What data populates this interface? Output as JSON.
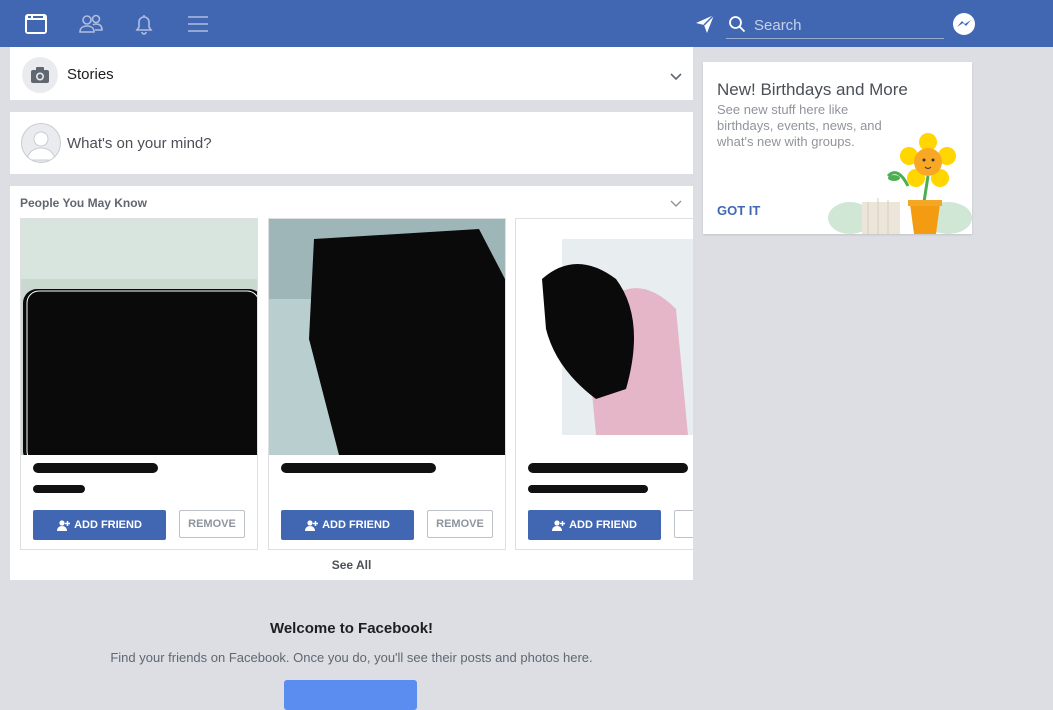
{
  "topbar": {
    "search": {
      "placeholder": "Search"
    },
    "icons": [
      "news-feed-icon",
      "friends-icon",
      "notifications-icon",
      "menu-icon",
      "send-icon",
      "search-icon",
      "messenger-icon"
    ]
  },
  "stories": {
    "label": "Stories"
  },
  "composer": {
    "prompt": "What's on your mind?"
  },
  "pymk": {
    "title": "People You May Know",
    "cards": [
      {
        "add_label": "ADD FRIEND",
        "remove_label": "REMOVE"
      },
      {
        "add_label": "ADD FRIEND",
        "remove_label": "REMOVE"
      },
      {
        "add_label": "ADD FRIEND"
      }
    ],
    "see_all": "See All"
  },
  "birthdays": {
    "title": "New! Birthdays and More",
    "description": "See new stuff here like birthdays, events, news, and what's new with groups.",
    "action": "GOT IT"
  },
  "welcome": {
    "title": "Welcome to Facebook!",
    "subtitle": "Find your friends on Facebook. Once you do, you'll see their posts and photos here."
  },
  "colors": {
    "brand": "#4267b2",
    "background": "#dcdee3"
  }
}
